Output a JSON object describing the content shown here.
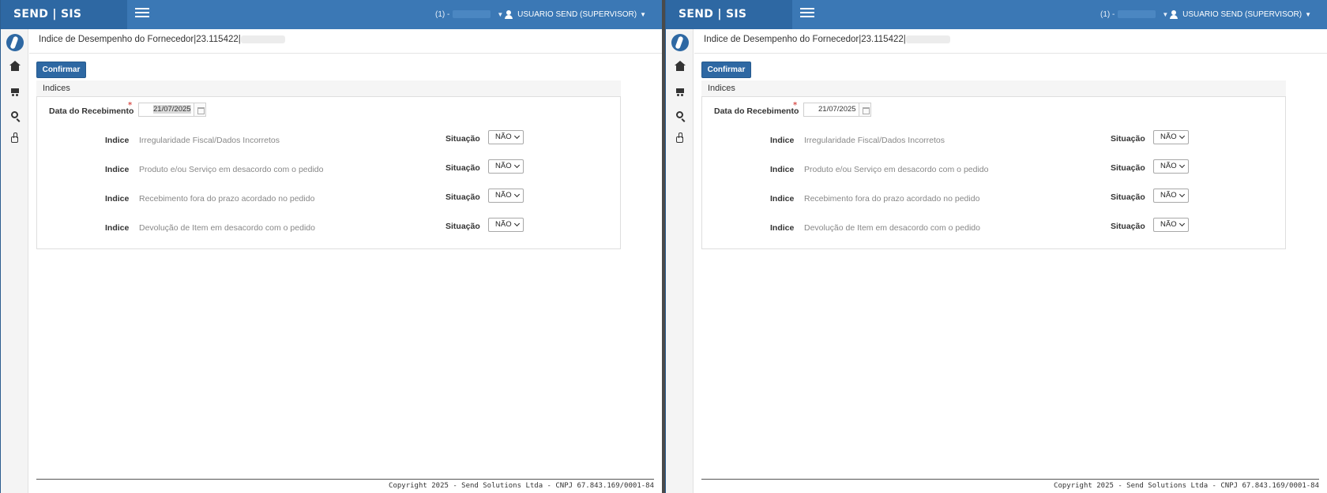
{
  "colors": {
    "topbar": "#3b78b5",
    "brand_bg": "#2e68a3",
    "primary_button": "#2e68a3",
    "required": "#d9534f"
  },
  "panes": [
    {
      "header": {
        "brand": "SEND | SIS",
        "org_prefix": "(1) -",
        "user": "USUARIO SEND (SUPERVISOR)"
      },
      "sidebar": {
        "icons": [
          "app-logo",
          "home-icon",
          "cart-icon",
          "search-icon",
          "thumbs-up-icon"
        ]
      },
      "page_title": "Indice de Desempenho do Fornecedor|23.115422|",
      "confirm_label": "Confirmar",
      "panel_title": "Indices",
      "date_label": "Data do Recebimento",
      "date_value": "21/07/2025",
      "date_selected": true,
      "index_label": "Indice",
      "status_label": "Situação",
      "indices": [
        {
          "text": "Irregularidade Fiscal/Dados Incorretos",
          "status": "NÃO"
        },
        {
          "text": "Produto e/ou Serviço em desacordo com o pedido",
          "status": "NÃO"
        },
        {
          "text": "Recebimento fora do prazo acordado no pedido",
          "status": "NÃO"
        },
        {
          "text": "Devolução de Item em desacordo com o pedido",
          "status": "NÃO"
        }
      ],
      "footer": "Copyright 2025 - Send Solutions Ltda - CNPJ 67.843.169/0001-84"
    },
    {
      "header": {
        "brand": "SEND | SIS",
        "org_prefix": "(1) -",
        "user": "USUARIO SEND (SUPERVISOR)"
      },
      "sidebar": {
        "icons": [
          "app-logo",
          "home-icon",
          "cart-icon",
          "search-icon",
          "thumbs-up-icon"
        ]
      },
      "page_title": "Indice de Desempenho do Fornecedor|23.115422|",
      "confirm_label": "Confirmar",
      "panel_title": "Indices",
      "date_label": "Data do Recebimento",
      "date_value": "21/07/2025",
      "date_selected": false,
      "index_label": "Indice",
      "status_label": "Situação",
      "indices": [
        {
          "text": "Irregularidade Fiscal/Dados Incorretos",
          "status": "NÃO"
        },
        {
          "text": "Produto e/ou Serviço em desacordo com o pedido",
          "status": "NÃO"
        },
        {
          "text": "Recebimento fora do prazo acordado no pedido",
          "status": "NÃO"
        },
        {
          "text": "Devolução de Item em desacordo com o pedido",
          "status": "NÃO"
        }
      ],
      "footer": "Copyright 2025 - Send Solutions Ltda - CNPJ 67.843.169/0001-84"
    }
  ]
}
